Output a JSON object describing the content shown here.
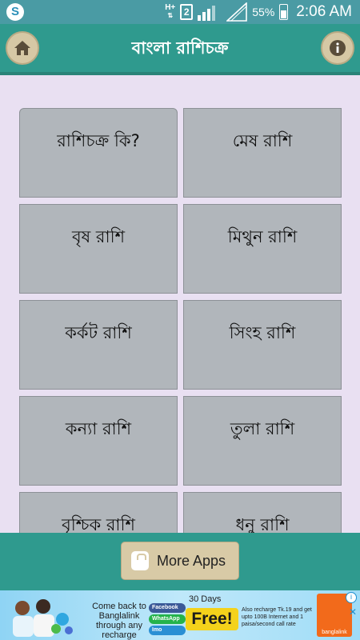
{
  "status_bar": {
    "network": "H+",
    "sim_slot": "2",
    "battery_percent": "55%",
    "battery_level": 0.55,
    "time": "2:06 AM",
    "notification_icon": "skype-icon"
  },
  "app_bar": {
    "title": "বাংলা রাশিচক্র",
    "home_icon": "home-icon",
    "info_icon": "info-icon"
  },
  "menu": {
    "items": [
      {
        "label": "রাশিচক্র কি?"
      },
      {
        "label": "মেষ রাশি"
      },
      {
        "label": "বৃষ রাশি"
      },
      {
        "label": "মিথুন রাশি"
      },
      {
        "label": "কর্কট রাশি"
      },
      {
        "label": "সিংহ রাশি"
      },
      {
        "label": "কন্যা রাশি"
      },
      {
        "label": "তুলা রাশি"
      },
      {
        "label": "বৃশ্চিক রাশি"
      },
      {
        "label": "ধনু রাশি"
      }
    ]
  },
  "footer": {
    "more_apps_label": "More Apps",
    "more_apps_icon": "shopping-bag-icon"
  },
  "ad": {
    "headline": "Come back to Banglalink through any recharge",
    "days": "30 Days",
    "apps": [
      "Facebook",
      "WhatsApp",
      "Imo"
    ],
    "free": "Free!",
    "recharge_text": "Also recharge Tk.19 and get upto 100B Internet and 1 paisa/second call rate",
    "brand": "banglalink",
    "colors": {
      "brand_orange": "#f26a1b",
      "free_yellow": "#f4d21b",
      "accent_teal": "#2f9a8e"
    }
  }
}
